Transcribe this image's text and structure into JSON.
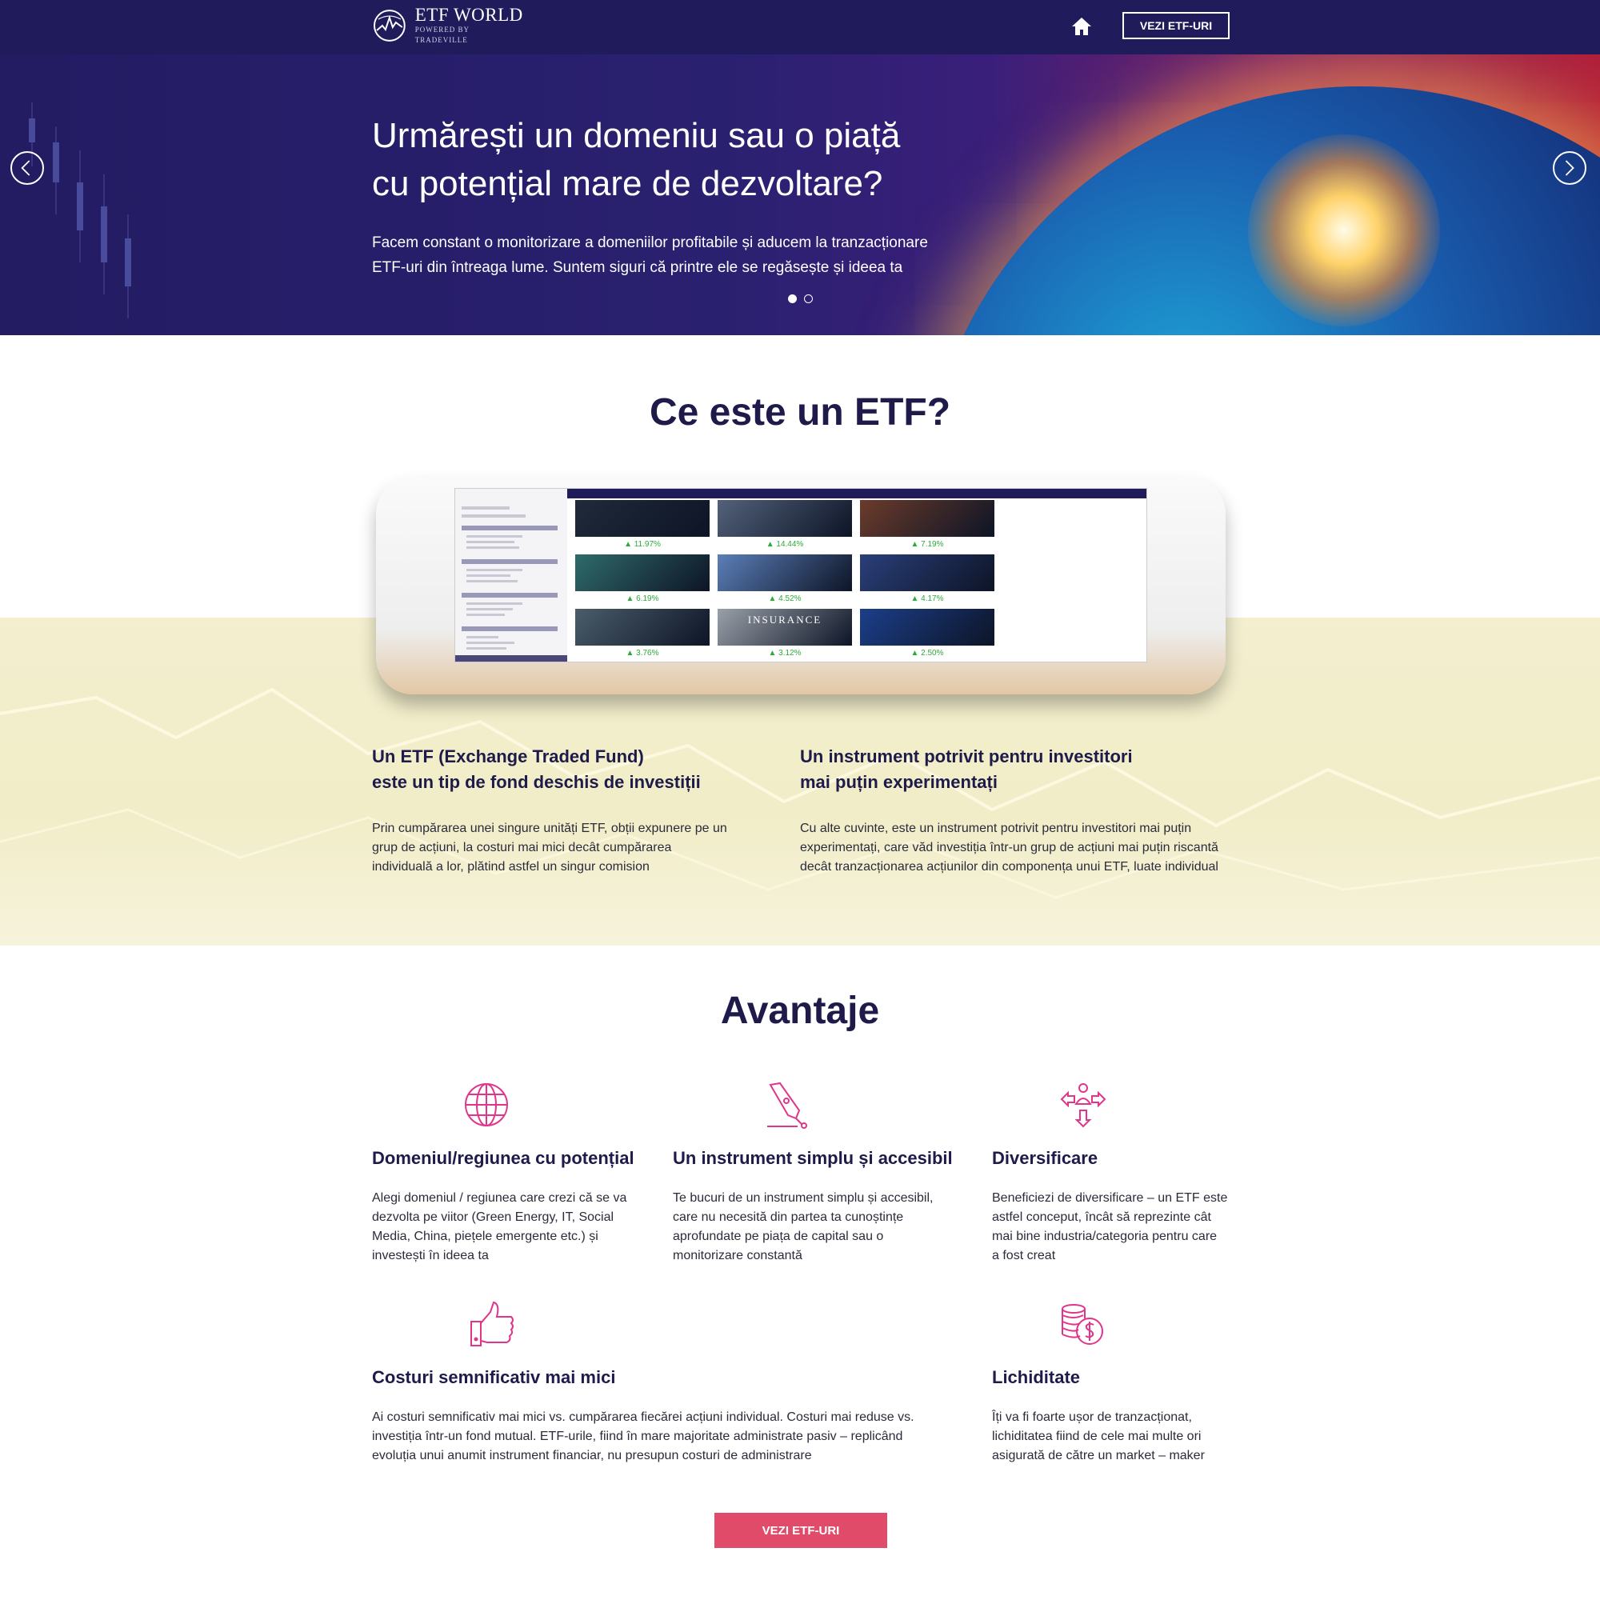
{
  "header": {
    "logo_title": "ETF WORLD",
    "logo_subtitle": "POWERED BY TRADEVILLE",
    "home_icon": "home-icon",
    "cta_label": "VEZI ETF-URI"
  },
  "hero": {
    "title_line1": "Urmărești un domeniu sau o piață",
    "title_line2": "cu potențial mare de dezvoltare?",
    "subtitle_line1": "Facem constant o monitorizare a domeniilor profitabile și aducem la tranzacționare",
    "subtitle_line2": "ETF-uri din întreaga lume. Suntem siguri că printre ele se regăsește și ideea ta",
    "slides_count": 2,
    "active_slide": 1
  },
  "what_is": {
    "title": "Ce este un ETF?",
    "left_title_line1": "Un ETF (Exchange Traded Fund)",
    "left_title_line2": "este un tip de fond deschis de investiții",
    "left_text_line1": "Prin cumpărarea unei singure unități ETF, obții expunere pe un",
    "left_text_line2": "grup de acțiuni, la costuri mai mici decât cumpărarea",
    "left_text_line3": "individuală a lor, plătind astfel un singur comision",
    "right_title_line1": "Un instrument potrivit pentru investitori",
    "right_title_line2": "mai puțin experimentați",
    "right_text_line1": "Cu alte cuvinte, este un instrument potrivit pentru investitori mai puțin",
    "right_text_line2": "experimentați, care văd investiția într-un grup de acțiuni mai puțin riscantă",
    "right_text_line3": "decât tranzacționarea acțiunilor din componența unui ETF, luate individual"
  },
  "tablet_screen": {
    "values": [
      "11.97%",
      "14.44%",
      "7.19%",
      "6.19%",
      "4.52%",
      "4.17%",
      "3.76%",
      "3.12%",
      "2.50%"
    ],
    "insurance_label": "INSURANCE"
  },
  "advantages": {
    "title": "Avantaje",
    "items": [
      {
        "icon": "globe-icon",
        "title": "Domeniul/regiunea cu potențial",
        "lines": [
          "Alegi domeniul / regiunea care crezi că se va",
          "dezvolta pe viitor (Green Energy, IT, Social",
          "Media, China, piețele emergente etc.) și",
          "investești în ideea ta"
        ]
      },
      {
        "icon": "pen-icon",
        "title": "Un instrument simplu și accesibil",
        "lines": [
          "Te bucuri de un instrument simplu și accesibil,",
          "care nu necesită din partea ta cunoștințe",
          "aprofundate pe piața de capital sau o",
          "monitorizare constantă"
        ]
      },
      {
        "icon": "diversify-arrows-icon",
        "title": "Diversificare",
        "lines": [
          "Beneficiezi de diversificare – un ETF este",
          "astfel conceput, încât să reprezinte cât",
          "mai bine industria/categoria pentru care",
          "a fost creat"
        ]
      },
      {
        "icon": "thumbs-up-icon",
        "title": "Costuri semnificativ mai mici",
        "lines": [
          "Ai costuri semnificativ mai mici vs. cumpărarea fiecărei acțiuni individual. Costuri mai reduse vs.",
          "investiția într-un fond mutual. ETF-urile, fiind în mare majoritate administrate pasiv – replicând",
          "evoluția unui anumit instrument financiar, nu presupun costuri de administrare"
        ]
      },
      {
        "icon": "coins-icon",
        "title": "Lichiditate",
        "lines": [
          "Îți va fi foarte ușor de tranzacționat,",
          "lichiditatea fiind de cele mai multe ori",
          "asigurată de către un market – maker"
        ]
      }
    ],
    "cta_label": "VEZI ETF-URI"
  },
  "colors": {
    "navy": "#201b5b",
    "accent_pink": "#e04b6a",
    "icon_pink": "#e0358a",
    "beige": "#f2eecc",
    "positive_green": "#2eaa3a"
  }
}
